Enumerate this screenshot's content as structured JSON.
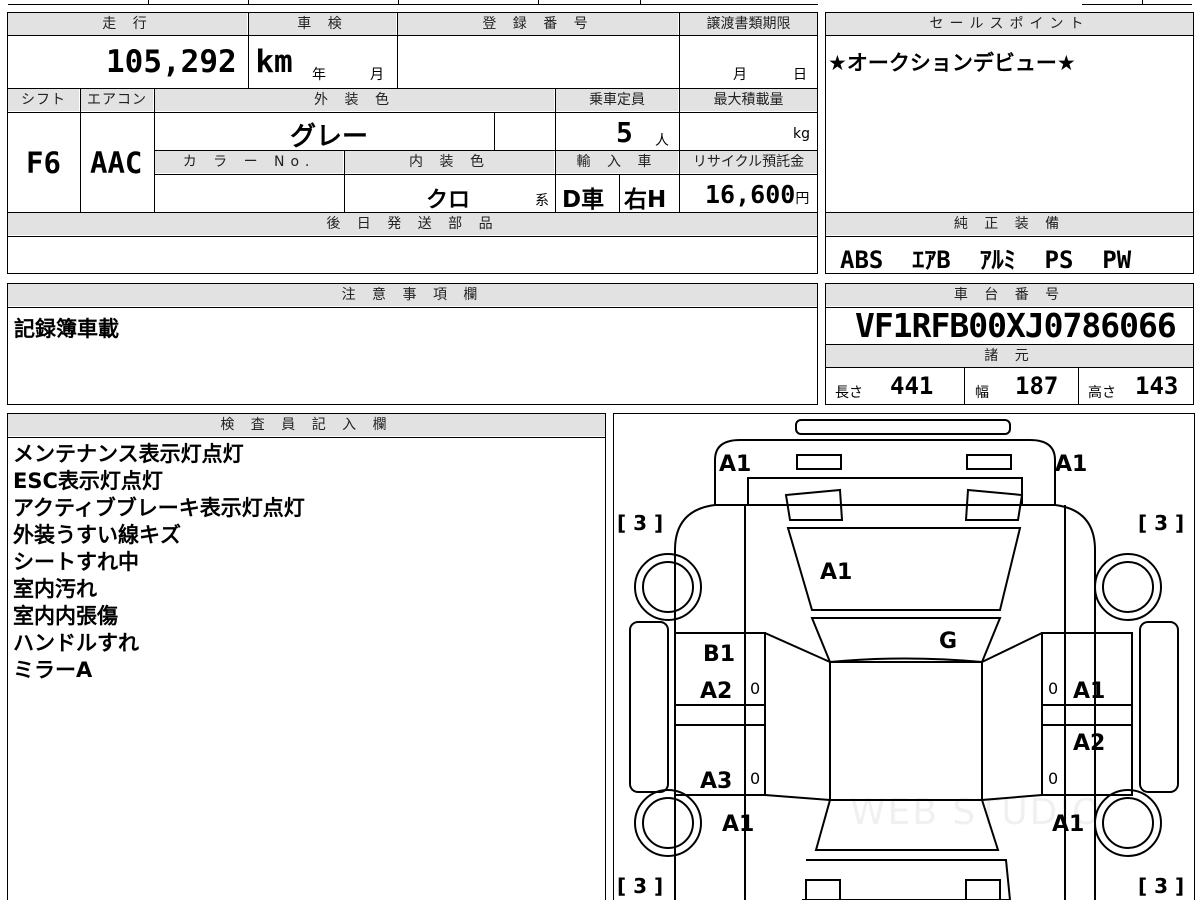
{
  "header_strip": {},
  "labels": {
    "mileage": "走 行",
    "inspection": "車 検",
    "reg_number": "登 録 番 号",
    "doc_deadline": "譲渡書類期限",
    "sales_points": "セールスポイント",
    "shift": "シフト",
    "aircon": "エアコン",
    "ext_color": "外 装 色",
    "capacity": "乗車定員",
    "max_load": "最大積載量",
    "color_no": "カ ラ ー No.",
    "int_color": "内 装 色",
    "import": "輸 入 車",
    "recycle": "リサイクル預託金",
    "later_parts": "後 日 発 送 部 品",
    "genuine_equip": "純 正 装 備",
    "notes": "注 意 事 項 欄",
    "chassis_no": "車 台 番 号",
    "specs": "諸 元",
    "inspector": "検 査 員 記 入 欄"
  },
  "vehicle": {
    "mileage_value": "105,292",
    "mileage_unit": "km",
    "inspection_year": "年",
    "inspection_month": "月",
    "deadline_month": "月",
    "deadline_day": "日",
    "shift": "F6",
    "aircon": "AAC",
    "ext_color": "グレー",
    "capacity": "5",
    "capacity_unit": "人",
    "max_load_unit": "kg",
    "int_color": "クロ",
    "int_color_suffix": "系",
    "import_type": "D車",
    "handle": "右H",
    "recycle_fee": "16,600",
    "recycle_unit": "円"
  },
  "sales_point_text": "★オークションデビュー★",
  "genuine_equipment": "ABS  ｴｱB  ｱﾙﾐ  PS  PW",
  "notes_text": "記録簿車載",
  "chassis_number": "VF1RFB00XJ0786066",
  "dimensions": {
    "length_label": "長さ",
    "length": "441",
    "width_label": "幅",
    "width": "187",
    "height_label": "高さ",
    "height": "143"
  },
  "inspector_notes": [
    "メンテナンス表示灯点灯",
    "ESC表示灯点灯",
    "アクティブブレーキ表示灯点灯",
    "外装うすい線キズ",
    "シートすれ中",
    "室内汚れ",
    "室内内張傷",
    "ハンドルすれ",
    "ミラーA"
  ],
  "diagram_marks": {
    "front_left": "A1",
    "front_right": "A1",
    "hood": "A1",
    "windshield": "G",
    "left_front_door_1": "B1",
    "left_front_door_2": "A2",
    "left_rear_door": "A3",
    "left_rear": "A1",
    "right_front_door": "A1",
    "right_rear_door": "A2",
    "right_rear": "A1",
    "tire_fl": "[ 3 ]",
    "tire_fr": "[ 3 ]",
    "tire_rl": "[ 3 ]",
    "tire_rr": "[ 3 ]",
    "zero": "0"
  },
  "watermark": "WEB STUDIO"
}
